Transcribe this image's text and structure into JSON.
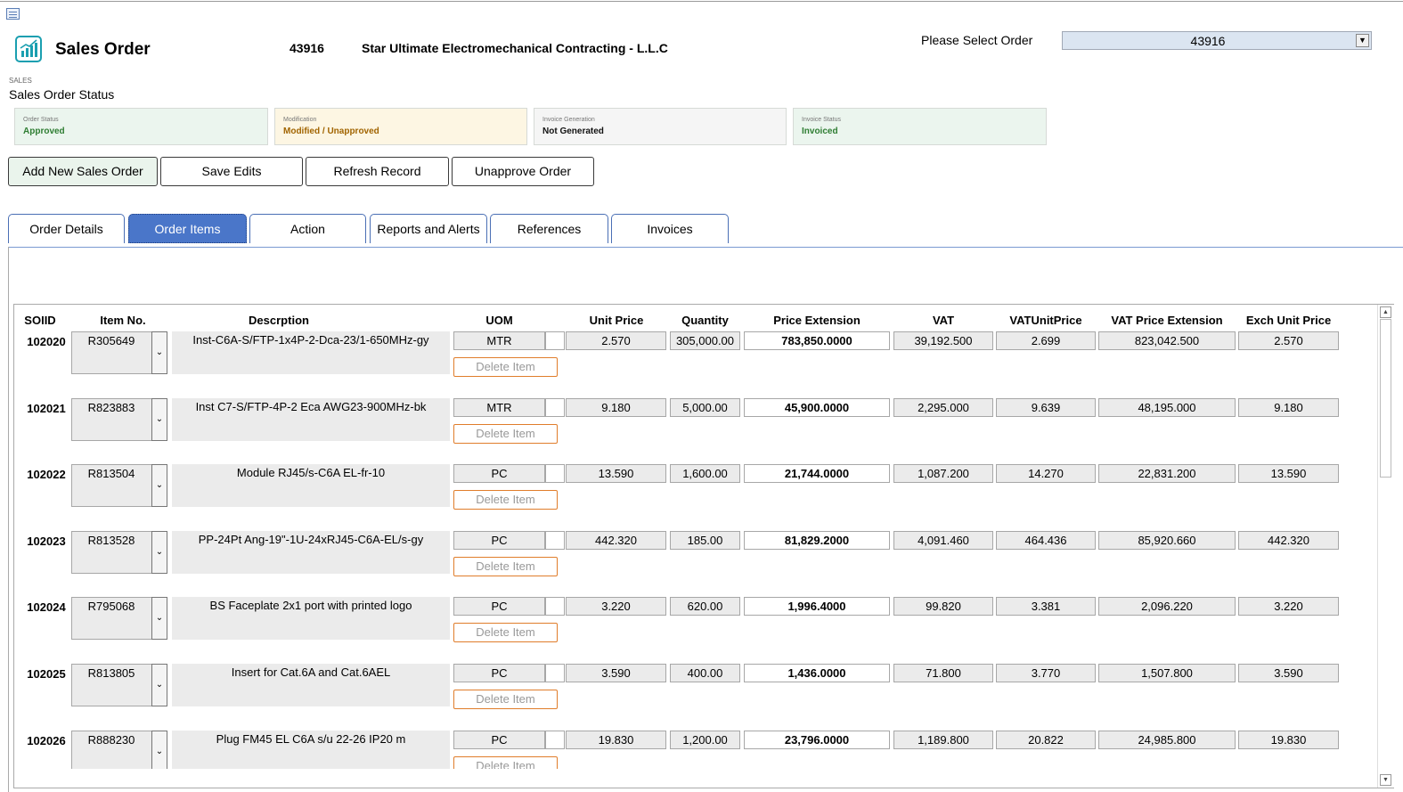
{
  "header": {
    "title": "Sales Order",
    "order_number": "43916",
    "customer_name": "Star Ultimate Electromechanical Contracting - L.L.C",
    "select_label": "Please Select Order",
    "select_value": "43916",
    "icon": "bar-chart-icon"
  },
  "status": {
    "section_small": "SALES",
    "section_title": "Sales Order Status",
    "cards": [
      {
        "label": "Order Status",
        "value": "Approved",
        "bg": "#ebf5ee",
        "color": "#2e7d32"
      },
      {
        "label": "Modification",
        "value": "Modified / Unapproved",
        "bg": "#fdf6e3",
        "color": "#a16400"
      },
      {
        "label": "Invoice Generation",
        "value": "Not Generated",
        "bg": "#f5f5f5",
        "color": "#111111"
      },
      {
        "label": "Invoice Status",
        "value": "Invoiced",
        "bg": "#ebf5ee",
        "color": "#2e7d32"
      }
    ]
  },
  "actions": {
    "add_new": "Add New Sales Order",
    "save": "Save Edits",
    "refresh": "Refresh Record",
    "unapprove": "Unapprove Order"
  },
  "tabs": [
    "Order Details",
    "Order Items",
    "Action",
    "Reports and Alerts",
    "References",
    "Invoices"
  ],
  "active_tab": "Order Items",
  "grid": {
    "columns": [
      "SOIID",
      "Item No.",
      "Descrption",
      "UOM",
      "Unit Price",
      "Quantity",
      "Price Extension",
      "VAT",
      "VATUnitPrice",
      "VAT Price Extension",
      "Exch Unit Price"
    ],
    "delete_label": "Delete Item",
    "rows": [
      {
        "soiid": "102020",
        "item": "R305649",
        "desc": "Inst-C6A-S/FTP-1x4P-2-Dca-23/1-650MHz-gy",
        "uom": "MTR",
        "unit_price": "2.570",
        "qty": "305,000.00",
        "ext": "783,850.0000",
        "vat": "39,192.500",
        "vat_unit": "2.699",
        "vat_ext": "823,042.500",
        "exch": "2.570"
      },
      {
        "soiid": "102021",
        "item": "R823883",
        "desc": "Inst C7-S/FTP-4P-2 Eca AWG23-900MHz-bk",
        "uom": "MTR",
        "unit_price": "9.180",
        "qty": "5,000.00",
        "ext": "45,900.0000",
        "vat": "2,295.000",
        "vat_unit": "9.639",
        "vat_ext": "48,195.000",
        "exch": "9.180"
      },
      {
        "soiid": "102022",
        "item": "R813504",
        "desc": "Module RJ45/s-C6A EL-fr-10",
        "uom": "PC",
        "unit_price": "13.590",
        "qty": "1,600.00",
        "ext": "21,744.0000",
        "vat": "1,087.200",
        "vat_unit": "14.270",
        "vat_ext": "22,831.200",
        "exch": "13.590"
      },
      {
        "soiid": "102023",
        "item": "R813528",
        "desc": "PP-24Pt Ang-19\"-1U-24xRJ45-C6A-EL/s-gy",
        "uom": "PC",
        "unit_price": "442.320",
        "qty": "185.00",
        "ext": "81,829.2000",
        "vat": "4,091.460",
        "vat_unit": "464.436",
        "vat_ext": "85,920.660",
        "exch": "442.320"
      },
      {
        "soiid": "102024",
        "item": "R795068",
        "desc": "BS Faceplate 2x1 port with printed logo",
        "uom": "PC",
        "unit_price": "3.220",
        "qty": "620.00",
        "ext": "1,996.4000",
        "vat": "99.820",
        "vat_unit": "3.381",
        "vat_ext": "2,096.220",
        "exch": "3.220"
      },
      {
        "soiid": "102025",
        "item": "R813805",
        "desc": "Insert for Cat.6A and Cat.6AEL",
        "uom": "PC",
        "unit_price": "3.590",
        "qty": "400.00",
        "ext": "1,436.0000",
        "vat": "71.800",
        "vat_unit": "3.770",
        "vat_ext": "1,507.800",
        "exch": "3.590"
      },
      {
        "soiid": "102026",
        "item": "R888230",
        "desc": "Plug FM45 EL C6A s/u 22-26 IP20 m",
        "uom": "PC",
        "unit_price": "19.830",
        "qty": "1,200.00",
        "ext": "23,796.0000",
        "vat": "1,189.800",
        "vat_unit": "20.822",
        "vat_ext": "24,985.800",
        "exch": "19.830"
      }
    ]
  }
}
